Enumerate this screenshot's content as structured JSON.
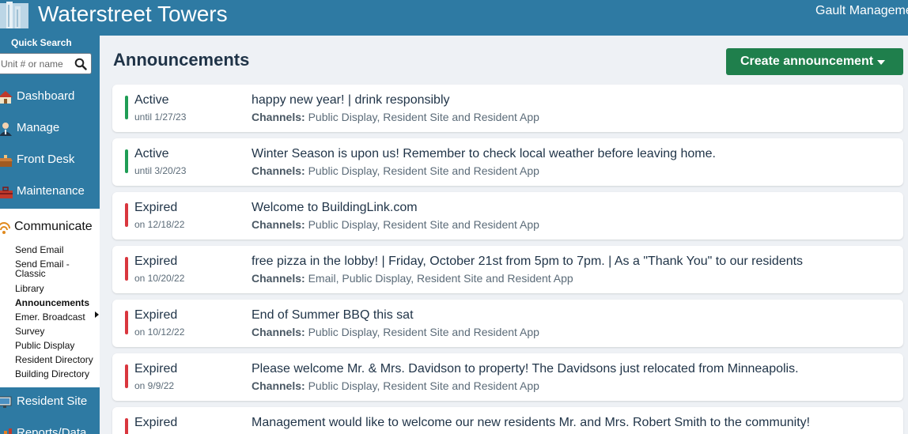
{
  "header": {
    "title": "Waterstreet Towers",
    "company": "Gault Manageme"
  },
  "sidebar": {
    "quick_search_label": "Quick Search",
    "search_placeholder": "Unit # or name",
    "items": [
      {
        "label": "Dashboard",
        "icon": "house-icon"
      },
      {
        "label": "Manage",
        "icon": "person-icon"
      },
      {
        "label": "Front Desk",
        "icon": "desk-icon"
      },
      {
        "label": "Maintenance",
        "icon": "toolbox-icon"
      }
    ],
    "communicate": {
      "label": "Communicate",
      "icon": "broadcast-icon",
      "sub_items": [
        "Send Email",
        "Send Email -",
        "Classic",
        "Library",
        "Announcements",
        "Emer. Broadcast",
        "Survey",
        "Public Display",
        "Resident Directory",
        "Building Directory"
      ],
      "active": "Announcements"
    },
    "bottom_items": [
      {
        "label": "Resident Site",
        "icon": "monitor-icon"
      },
      {
        "label": "Reports/Data",
        "icon": "chart-icon"
      }
    ]
  },
  "main": {
    "page_title": "Announcements",
    "create_button": "Create announcement",
    "channels_label": "Channels:",
    "announcements": [
      {
        "status": "Active",
        "date": "until 1/27/23",
        "title": "happy new year! | drink responsibly",
        "channels": "Public Display, Resident Site and Resident App"
      },
      {
        "status": "Active",
        "date": "until 3/20/23",
        "title": "Winter Season is upon us! Remember to check local weather before leaving home.",
        "channels": "Public Display, Resident Site and Resident App"
      },
      {
        "status": "Expired",
        "date": "on 12/18/22",
        "title": "Welcome to BuildingLink.com",
        "channels": "Public Display, Resident Site and Resident App"
      },
      {
        "status": "Expired",
        "date": "on 10/20/22",
        "title": "free pizza in the lobby! | Friday, October 21st from 5pm to 7pm. | As a \"Thank You\" to our residents",
        "channels": "Email, Public Display, Resident Site and Resident App"
      },
      {
        "status": "Expired",
        "date": "on 10/12/22",
        "title": "End of Summer BBQ this sat",
        "channels": "Public Display, Resident Site and Resident App"
      },
      {
        "status": "Expired",
        "date": "on 9/9/22",
        "title": "Please welcome Mr. & Mrs. Davidson to property! The Davidsons just relocated from Minneapolis.",
        "channels": "Public Display, Resident Site and Resident App"
      },
      {
        "status": "Expired",
        "date": "",
        "title": "Management would like to welcome our new residents Mr. and Mrs. Robert Smith to the community!",
        "channels": ""
      }
    ]
  },
  "colors": {
    "brand": "#2e7aa3",
    "primary_button": "#1f7f4c",
    "active": "#1f9d55",
    "expired": "#d9363e"
  }
}
